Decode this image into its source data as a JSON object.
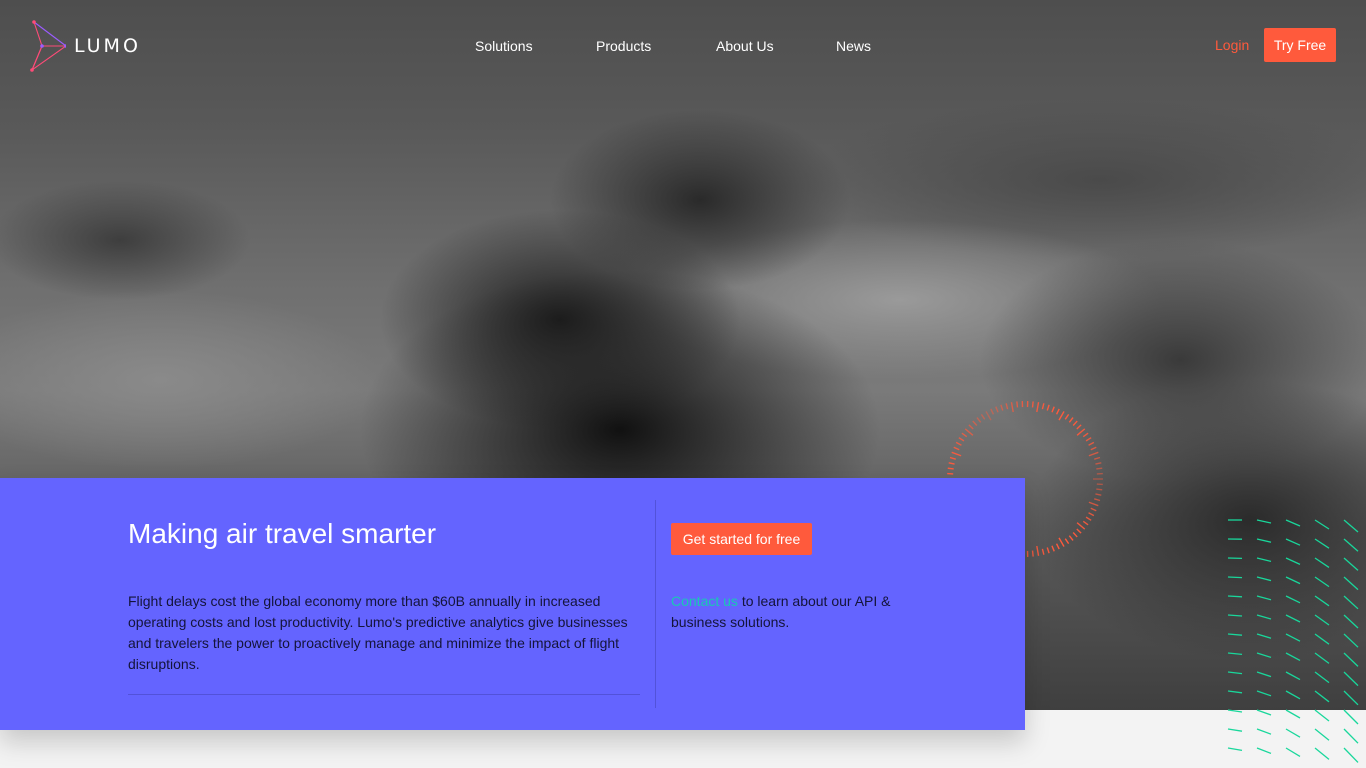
{
  "brand": {
    "name": "LUMO"
  },
  "nav": {
    "items": [
      {
        "label": "Solutions"
      },
      {
        "label": "Products"
      },
      {
        "label": "About Us"
      },
      {
        "label": "News"
      }
    ],
    "login": "Login",
    "try_free": "Try Free"
  },
  "hero": {
    "title": "Making air travel smarter",
    "description": "Flight delays cost the global economy more than $60B annually in increased operating costs and lost productivity. Lumo's predictive analytics give businesses and travelers the power to proactively manage and minimize the impact of flight disruptions.",
    "cta_label": "Get started for free",
    "contact_link": "Contact us",
    "contact_text": " to learn about our API & business solutions."
  },
  "colors": {
    "accent": "#ff5a3c",
    "card": "#6464ff",
    "link": "#19c8b4",
    "dash": "#19d79b"
  },
  "icons": {
    "logo": "constellation-logo-icon",
    "dial": "radial-dial-decoration",
    "dashes": "dash-pattern-decoration"
  }
}
